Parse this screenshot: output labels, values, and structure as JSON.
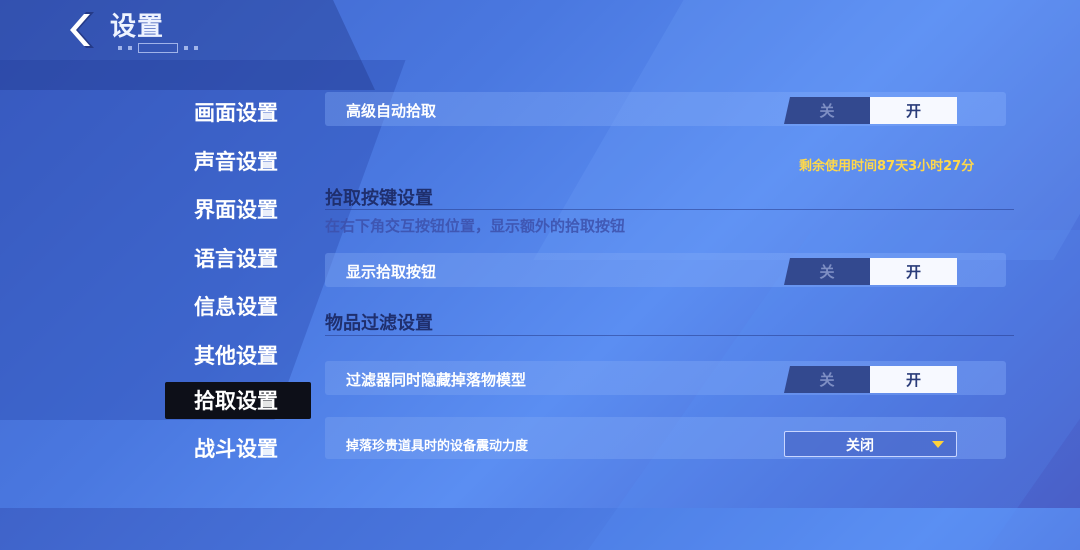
{
  "header": {
    "title": "设置"
  },
  "sidebar": {
    "items": [
      {
        "label": "画面设置"
      },
      {
        "label": "声音设置"
      },
      {
        "label": "界面设置"
      },
      {
        "label": "语言设置"
      },
      {
        "label": "信息设置"
      },
      {
        "label": "其他设置"
      },
      {
        "label": "拾取设置",
        "active": true
      },
      {
        "label": "战斗设置"
      }
    ]
  },
  "toggle_labels": {
    "off": "关",
    "on": "开"
  },
  "settings": {
    "advanced_pickup": {
      "label": "高级自动拾取",
      "state": "开"
    },
    "remaining_time": "剩余使用时间87天3小时27分",
    "pickup_key_section": {
      "title": "拾取按键设置",
      "desc": "在右下角交互按钮位置，显示额外的拾取按钮"
    },
    "show_pickup_button": {
      "label": "显示拾取按钮",
      "state": "开"
    },
    "item_filter_section": {
      "title": "物品过滤设置"
    },
    "hide_drop_model": {
      "label": "过滤器同时隐藏掉落物模型",
      "state": "开"
    },
    "vibration": {
      "label": "掉落珍贵道具时的设备震动力度",
      "value": "关闭"
    }
  },
  "colors": {
    "accent_yellow": "#ffd84a",
    "active_tab": "#0d0f18"
  }
}
